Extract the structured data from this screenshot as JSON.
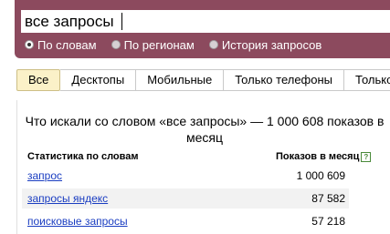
{
  "search": {
    "query": "все запросы",
    "modes": [
      {
        "label": "По словам",
        "checked": true
      },
      {
        "label": "По регионам",
        "checked": false
      },
      {
        "label": "История запросов",
        "checked": false
      }
    ]
  },
  "tabs": [
    "Все",
    "Десктопы",
    "Мобильные",
    "Только телефоны",
    "Только"
  ],
  "results": {
    "heading": "Что искали со словом «все запросы» — 1 000 608 показов в месяц",
    "col_left": "Статистика по словам",
    "col_right": "Показов в месяц",
    "help": "?",
    "rows": [
      {
        "keyword": "запрос",
        "count": "1 000 609"
      },
      {
        "keyword": "запросы яндекс",
        "count": "87 582"
      },
      {
        "keyword": "поисковые запросы",
        "count": "57 218"
      }
    ]
  },
  "colors": {
    "panel": "#8c4a5e",
    "link": "#1a3dc1",
    "active_tab": "#fbf1c8"
  }
}
